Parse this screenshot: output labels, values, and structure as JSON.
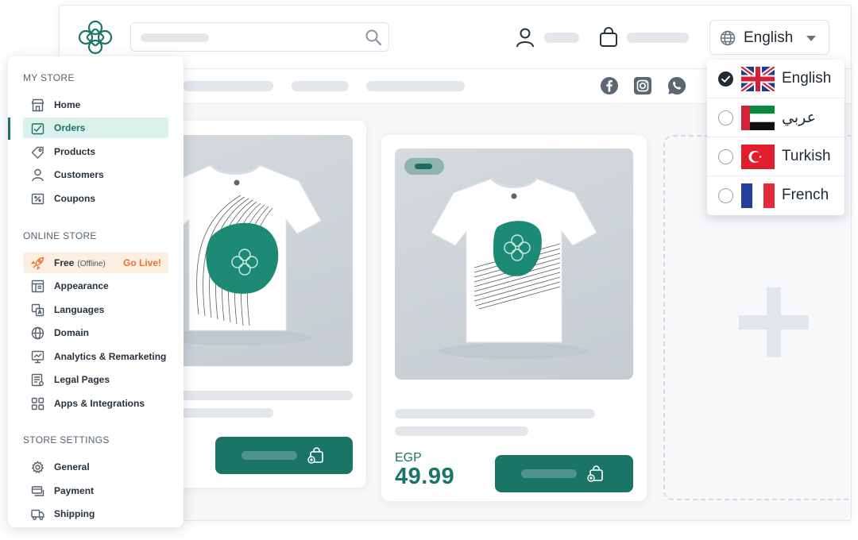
{
  "header": {
    "language_selector": "English"
  },
  "language_menu": {
    "options": [
      {
        "label": "English",
        "selected": true,
        "flag": "uk-flag-icon"
      },
      {
        "label": "عربي",
        "selected": false,
        "flag": "uae-flag-icon"
      },
      {
        "label": "Turkish",
        "selected": false,
        "flag": "turkey-flag-icon"
      },
      {
        "label": "French",
        "selected": false,
        "flag": "france-flag-icon"
      }
    ]
  },
  "products": [
    {
      "image": "tshirt-wave-print"
    },
    {
      "image": "tshirt-stripes-print",
      "price_currency": "EGP",
      "price_value": "49.99"
    }
  ],
  "sidebar": {
    "sections": [
      {
        "title": "MY STORE",
        "items": [
          {
            "label": "Home",
            "icon": "store-icon"
          },
          {
            "label": "Orders",
            "icon": "orders-icon",
            "active": true
          },
          {
            "label": "Products",
            "icon": "tag-icon"
          },
          {
            "label": "Customers",
            "icon": "person-icon"
          },
          {
            "label": "Coupons",
            "icon": "percent-icon"
          }
        ]
      },
      {
        "title": "ONLINE STORE",
        "items": [
          {
            "label": "Free",
            "sublabel": "(Offline)",
            "action": "Go Live!",
            "icon": "rocket-icon"
          },
          {
            "label": "Appearance",
            "icon": "layout-icon"
          },
          {
            "label": "Languages",
            "icon": "translate-icon"
          },
          {
            "label": "Domain",
            "icon": "globe-icon"
          },
          {
            "label": "Analytics & Remarketing",
            "icon": "analytics-icon"
          },
          {
            "label": "Legal Pages",
            "icon": "document-icon"
          },
          {
            "label": "Apps & Integrations",
            "icon": "apps-icon"
          }
        ]
      },
      {
        "title": "STORE SETTINGS",
        "items": [
          {
            "label": "General",
            "icon": "gear-icon"
          },
          {
            "label": "Payment",
            "icon": "payment-icon"
          },
          {
            "label": "Shipping",
            "icon": "truck-icon"
          }
        ]
      }
    ]
  },
  "colors": {
    "brand": "#1b7566",
    "active_bg": "#daf1ec",
    "go_live": "#e8742e"
  }
}
